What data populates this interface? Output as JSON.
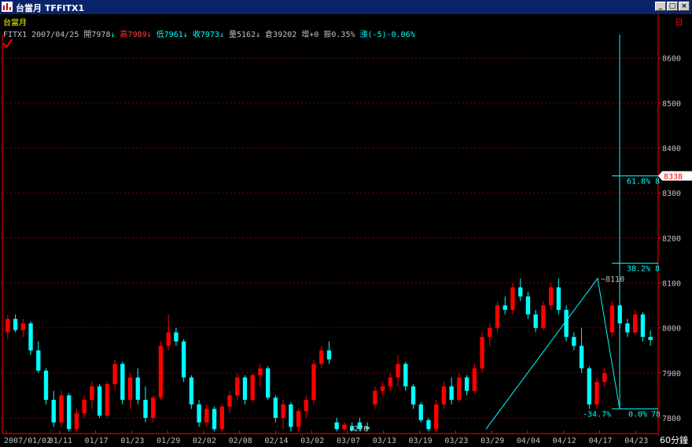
{
  "window": {
    "title": "台當月 TFFITX1",
    "minimize_glyph": "_",
    "restore_glyph": "□",
    "close_glyph": "×",
    "corner_label": "日"
  },
  "info": {
    "name": "台當月",
    "symbol": "FITX1",
    "date": "2007/04/25",
    "open": {
      "label": "開",
      "value": "7978",
      "arrow": "↓"
    },
    "high": {
      "label": "高",
      "value": "7989",
      "arrow": "↓"
    },
    "low": {
      "label": "低",
      "value": "7961",
      "arrow": "↓"
    },
    "close": {
      "label": "收",
      "value": "7973",
      "arrow": "↓"
    },
    "volume": {
      "label": "量",
      "value": "5162",
      "arrow": "↓"
    },
    "oi": {
      "label": "倉",
      "value": "39202"
    },
    "oi_change": "增+0",
    "amplitude": "振0.35%",
    "change": "漲(-5)-0.06%"
  },
  "colors": {
    "background": "#000000",
    "axis": "#ff0000",
    "grid": "#800000",
    "up": "#ff0000",
    "down": "#00ffff",
    "text": "#c0c0c0",
    "cyan": "#00ffff",
    "yellow": "#ffff00",
    "price_tag_bg": "#ffffff",
    "price_tag_fg": "#ff0000"
  },
  "chart_data": {
    "type": "candlestick",
    "period_label": "60分鐘",
    "y_ticks": [
      "7800",
      "7900",
      "8000",
      "8100",
      "8200",
      "8300",
      "8400",
      "8500",
      "8600"
    ],
    "ylim": [
      7765,
      8652
    ],
    "x_ticks": [
      "2007/01/02",
      "01/11",
      "01/17",
      "01/23",
      "01/29",
      "02/02",
      "02/08",
      "02/14",
      "03/02",
      "03/07",
      "03/13",
      "03/19",
      "03/23",
      "03/29",
      "04/04",
      "04/12",
      "04/17",
      "04/23"
    ],
    "current_price": "8338",
    "fib_levels": [
      {
        "label": "61.8%",
        "price": 8338
      },
      {
        "label": "38.2%",
        "price": 8144
      },
      {
        "label": "0.0%",
        "price": 7820
      }
    ],
    "fib_extra_label": "-34.7%",
    "fib_edge_label": "78",
    "fib_cut_marker": "8",
    "fib_cut_marker_2": "8",
    "trend_points": [
      {
        "date": "03/23",
        "price": 7775
      },
      {
        "date": "04/12",
        "price": 8110
      },
      {
        "date": "04/17",
        "price": 7820
      }
    ],
    "annotations": [
      {
        "text": "8110",
        "price": 8110
      },
      {
        "text": "7270",
        "price": 7770
      }
    ],
    "bars": [
      {
        "o": 7990,
        "h": 8030,
        "l": 7975,
        "c": 8020
      },
      {
        "o": 8020,
        "h": 8030,
        "l": 7990,
        "c": 7995
      },
      {
        "o": 7995,
        "h": 8020,
        "l": 7980,
        "c": 8010
      },
      {
        "o": 8010,
        "h": 8015,
        "l": 7940,
        "c": 7950
      },
      {
        "o": 7950,
        "h": 7970,
        "l": 7900,
        "c": 7905
      },
      {
        "o": 7905,
        "h": 7910,
        "l": 7830,
        "c": 7840
      },
      {
        "o": 7840,
        "h": 7860,
        "l": 7780,
        "c": 7790
      },
      {
        "o": 7790,
        "h": 7860,
        "l": 7780,
        "c": 7850
      },
      {
        "o": 7850,
        "h": 7855,
        "l": 7770,
        "c": 7775
      },
      {
        "o": 7775,
        "h": 7820,
        "l": 7770,
        "c": 7810
      },
      {
        "o": 7810,
        "h": 7850,
        "l": 7800,
        "c": 7840
      },
      {
        "o": 7840,
        "h": 7880,
        "l": 7820,
        "c": 7870
      },
      {
        "o": 7870,
        "h": 7875,
        "l": 7800,
        "c": 7805
      },
      {
        "o": 7805,
        "h": 7880,
        "l": 7800,
        "c": 7875
      },
      {
        "o": 7875,
        "h": 7930,
        "l": 7860,
        "c": 7920
      },
      {
        "o": 7920,
        "h": 7925,
        "l": 7830,
        "c": 7840
      },
      {
        "o": 7840,
        "h": 7900,
        "l": 7820,
        "c": 7890
      },
      {
        "o": 7890,
        "h": 7910,
        "l": 7830,
        "c": 7840
      },
      {
        "o": 7840,
        "h": 7870,
        "l": 7790,
        "c": 7800
      },
      {
        "o": 7800,
        "h": 7850,
        "l": 7790,
        "c": 7845
      },
      {
        "o": 7845,
        "h": 7970,
        "l": 7840,
        "c": 7960
      },
      {
        "o": 7960,
        "h": 8030,
        "l": 7950,
        "c": 7990
      },
      {
        "o": 7990,
        "h": 8000,
        "l": 7960,
        "c": 7970
      },
      {
        "o": 7970,
        "h": 7975,
        "l": 7880,
        "c": 7890
      },
      {
        "o": 7890,
        "h": 7895,
        "l": 7820,
        "c": 7830
      },
      {
        "o": 7830,
        "h": 7840,
        "l": 7780,
        "c": 7790
      },
      {
        "o": 7790,
        "h": 7830,
        "l": 7780,
        "c": 7820
      },
      {
        "o": 7820,
        "h": 7825,
        "l": 7770,
        "c": 7775
      },
      {
        "o": 7775,
        "h": 7830,
        "l": 7770,
        "c": 7825
      },
      {
        "o": 7825,
        "h": 7860,
        "l": 7810,
        "c": 7850
      },
      {
        "o": 7850,
        "h": 7900,
        "l": 7840,
        "c": 7890
      },
      {
        "o": 7890,
        "h": 7895,
        "l": 7830,
        "c": 7840
      },
      {
        "o": 7840,
        "h": 7900,
        "l": 7835,
        "c": 7895
      },
      {
        "o": 7895,
        "h": 7920,
        "l": 7870,
        "c": 7910
      },
      {
        "o": 7910,
        "h": 7915,
        "l": 7840,
        "c": 7845
      },
      {
        "o": 7845,
        "h": 7850,
        "l": 7790,
        "c": 7800
      },
      {
        "o": 7800,
        "h": 7840,
        "l": 7775,
        "c": 7830
      },
      {
        "o": 7830,
        "h": 7835,
        "l": 7770,
        "c": 7780
      },
      {
        "o": 7780,
        "h": 7820,
        "l": 7770,
        "c": 7815
      },
      {
        "o": 7815,
        "h": 7850,
        "l": 7800,
        "c": 7840
      },
      {
        "o": 7840,
        "h": 7930,
        "l": 7830,
        "c": 7920
      },
      {
        "o": 7920,
        "h": 7960,
        "l": 7910,
        "c": 7950
      },
      {
        "o": 7950,
        "h": 7970,
        "l": 7920,
        "c": 7930
      },
      {
        "o": 7790,
        "h": 7800,
        "l": 7770,
        "c": 7775
      },
      {
        "o": 7775,
        "h": 7790,
        "l": 7770,
        "c": 7785
      },
      {
        "o": 7780,
        "h": 7790,
        "l": 7770,
        "c": 7772
      },
      {
        "o": 7790,
        "h": 7800,
        "l": 7770,
        "c": 7775
      },
      {
        "o": 7780,
        "h": 7790,
        "l": 7770,
        "c": 7775
      },
      {
        "o": 7830,
        "h": 7870,
        "l": 7820,
        "c": 7860
      },
      {
        "o": 7860,
        "h": 7880,
        "l": 7850,
        "c": 7870
      },
      {
        "o": 7870,
        "h": 7900,
        "l": 7860,
        "c": 7890
      },
      {
        "o": 7890,
        "h": 7940,
        "l": 7870,
        "c": 7920
      },
      {
        "o": 7920,
        "h": 7925,
        "l": 7860,
        "c": 7870
      },
      {
        "o": 7870,
        "h": 7875,
        "l": 7820,
        "c": 7830
      },
      {
        "o": 7830,
        "h": 7835,
        "l": 7790,
        "c": 7795
      },
      {
        "o": 7795,
        "h": 7800,
        "l": 7770,
        "c": 7775
      },
      {
        "o": 7775,
        "h": 7840,
        "l": 7770,
        "c": 7830
      },
      {
        "o": 7830,
        "h": 7880,
        "l": 7820,
        "c": 7870
      },
      {
        "o": 7870,
        "h": 7890,
        "l": 7830,
        "c": 7840
      },
      {
        "o": 7840,
        "h": 7900,
        "l": 7835,
        "c": 7890
      },
      {
        "o": 7890,
        "h": 7895,
        "l": 7850,
        "c": 7860
      },
      {
        "o": 7860,
        "h": 7920,
        "l": 7855,
        "c": 7910
      },
      {
        "o": 7910,
        "h": 7990,
        "l": 7900,
        "c": 7980
      },
      {
        "o": 7980,
        "h": 8010,
        "l": 7960,
        "c": 8000
      },
      {
        "o": 8000,
        "h": 8060,
        "l": 7990,
        "c": 8050
      },
      {
        "o": 8050,
        "h": 8070,
        "l": 8030,
        "c": 8040
      },
      {
        "o": 8040,
        "h": 8100,
        "l": 8030,
        "c": 8090
      },
      {
        "o": 8090,
        "h": 8110,
        "l": 8060,
        "c": 8070
      },
      {
        "o": 8070,
        "h": 8080,
        "l": 8020,
        "c": 8030
      },
      {
        "o": 8030,
        "h": 8040,
        "l": 7990,
        "c": 8000
      },
      {
        "o": 8000,
        "h": 8060,
        "l": 7995,
        "c": 8050
      },
      {
        "o": 8050,
        "h": 8100,
        "l": 8040,
        "c": 8090
      },
      {
        "o": 8090,
        "h": 8110,
        "l": 8030,
        "c": 8040
      },
      {
        "o": 8040,
        "h": 8050,
        "l": 7970,
        "c": 7980
      },
      {
        "o": 7980,
        "h": 7990,
        "l": 7950,
        "c": 7960
      },
      {
        "o": 7960,
        "h": 8000,
        "l": 7900,
        "c": 7910
      },
      {
        "o": 7910,
        "h": 7915,
        "l": 7820,
        "c": 7830
      },
      {
        "o": 7830,
        "h": 7890,
        "l": 7820,
        "c": 7880
      },
      {
        "o": 7880,
        "h": 7910,
        "l": 7870,
        "c": 7900
      },
      {
        "o": 7990,
        "h": 8060,
        "l": 7980,
        "c": 8050
      },
      {
        "o": 8050,
        "h": 8055,
        "l": 8000,
        "c": 8010
      },
      {
        "o": 8010,
        "h": 8020,
        "l": 7980,
        "c": 7990
      },
      {
        "o": 7990,
        "h": 8040,
        "l": 7985,
        "c": 8030
      },
      {
        "o": 8030,
        "h": 8035,
        "l": 7970,
        "c": 7980
      },
      {
        "o": 7980,
        "h": 7995,
        "l": 7960,
        "c": 7973
      }
    ]
  }
}
